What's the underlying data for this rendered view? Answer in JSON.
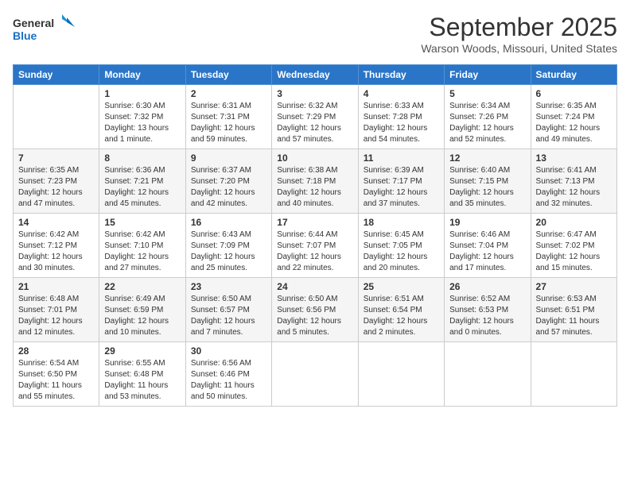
{
  "logo": {
    "line1": "General",
    "line2": "Blue"
  },
  "title": "September 2025",
  "location": "Warson Woods, Missouri, United States",
  "weekdays": [
    "Sunday",
    "Monday",
    "Tuesday",
    "Wednesday",
    "Thursday",
    "Friday",
    "Saturday"
  ],
  "weeks": [
    [
      {
        "day": "",
        "info": ""
      },
      {
        "day": "1",
        "info": "Sunrise: 6:30 AM\nSunset: 7:32 PM\nDaylight: 13 hours\nand 1 minute."
      },
      {
        "day": "2",
        "info": "Sunrise: 6:31 AM\nSunset: 7:31 PM\nDaylight: 12 hours\nand 59 minutes."
      },
      {
        "day": "3",
        "info": "Sunrise: 6:32 AM\nSunset: 7:29 PM\nDaylight: 12 hours\nand 57 minutes."
      },
      {
        "day": "4",
        "info": "Sunrise: 6:33 AM\nSunset: 7:28 PM\nDaylight: 12 hours\nand 54 minutes."
      },
      {
        "day": "5",
        "info": "Sunrise: 6:34 AM\nSunset: 7:26 PM\nDaylight: 12 hours\nand 52 minutes."
      },
      {
        "day": "6",
        "info": "Sunrise: 6:35 AM\nSunset: 7:24 PM\nDaylight: 12 hours\nand 49 minutes."
      }
    ],
    [
      {
        "day": "7",
        "info": "Sunrise: 6:35 AM\nSunset: 7:23 PM\nDaylight: 12 hours\nand 47 minutes."
      },
      {
        "day": "8",
        "info": "Sunrise: 6:36 AM\nSunset: 7:21 PM\nDaylight: 12 hours\nand 45 minutes."
      },
      {
        "day": "9",
        "info": "Sunrise: 6:37 AM\nSunset: 7:20 PM\nDaylight: 12 hours\nand 42 minutes."
      },
      {
        "day": "10",
        "info": "Sunrise: 6:38 AM\nSunset: 7:18 PM\nDaylight: 12 hours\nand 40 minutes."
      },
      {
        "day": "11",
        "info": "Sunrise: 6:39 AM\nSunset: 7:17 PM\nDaylight: 12 hours\nand 37 minutes."
      },
      {
        "day": "12",
        "info": "Sunrise: 6:40 AM\nSunset: 7:15 PM\nDaylight: 12 hours\nand 35 minutes."
      },
      {
        "day": "13",
        "info": "Sunrise: 6:41 AM\nSunset: 7:13 PM\nDaylight: 12 hours\nand 32 minutes."
      }
    ],
    [
      {
        "day": "14",
        "info": "Sunrise: 6:42 AM\nSunset: 7:12 PM\nDaylight: 12 hours\nand 30 minutes."
      },
      {
        "day": "15",
        "info": "Sunrise: 6:42 AM\nSunset: 7:10 PM\nDaylight: 12 hours\nand 27 minutes."
      },
      {
        "day": "16",
        "info": "Sunrise: 6:43 AM\nSunset: 7:09 PM\nDaylight: 12 hours\nand 25 minutes."
      },
      {
        "day": "17",
        "info": "Sunrise: 6:44 AM\nSunset: 7:07 PM\nDaylight: 12 hours\nand 22 minutes."
      },
      {
        "day": "18",
        "info": "Sunrise: 6:45 AM\nSunset: 7:05 PM\nDaylight: 12 hours\nand 20 minutes."
      },
      {
        "day": "19",
        "info": "Sunrise: 6:46 AM\nSunset: 7:04 PM\nDaylight: 12 hours\nand 17 minutes."
      },
      {
        "day": "20",
        "info": "Sunrise: 6:47 AM\nSunset: 7:02 PM\nDaylight: 12 hours\nand 15 minutes."
      }
    ],
    [
      {
        "day": "21",
        "info": "Sunrise: 6:48 AM\nSunset: 7:01 PM\nDaylight: 12 hours\nand 12 minutes."
      },
      {
        "day": "22",
        "info": "Sunrise: 6:49 AM\nSunset: 6:59 PM\nDaylight: 12 hours\nand 10 minutes."
      },
      {
        "day": "23",
        "info": "Sunrise: 6:50 AM\nSunset: 6:57 PM\nDaylight: 12 hours\nand 7 minutes."
      },
      {
        "day": "24",
        "info": "Sunrise: 6:50 AM\nSunset: 6:56 PM\nDaylight: 12 hours\nand 5 minutes."
      },
      {
        "day": "25",
        "info": "Sunrise: 6:51 AM\nSunset: 6:54 PM\nDaylight: 12 hours\nand 2 minutes."
      },
      {
        "day": "26",
        "info": "Sunrise: 6:52 AM\nSunset: 6:53 PM\nDaylight: 12 hours\nand 0 minutes."
      },
      {
        "day": "27",
        "info": "Sunrise: 6:53 AM\nSunset: 6:51 PM\nDaylight: 11 hours\nand 57 minutes."
      }
    ],
    [
      {
        "day": "28",
        "info": "Sunrise: 6:54 AM\nSunset: 6:50 PM\nDaylight: 11 hours\nand 55 minutes."
      },
      {
        "day": "29",
        "info": "Sunrise: 6:55 AM\nSunset: 6:48 PM\nDaylight: 11 hours\nand 53 minutes."
      },
      {
        "day": "30",
        "info": "Sunrise: 6:56 AM\nSunset: 6:46 PM\nDaylight: 11 hours\nand 50 minutes."
      },
      {
        "day": "",
        "info": ""
      },
      {
        "day": "",
        "info": ""
      },
      {
        "day": "",
        "info": ""
      },
      {
        "day": "",
        "info": ""
      }
    ]
  ]
}
